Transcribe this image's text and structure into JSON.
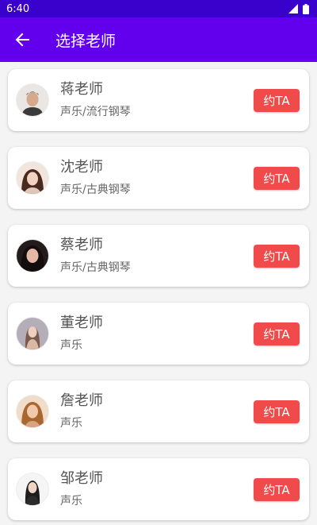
{
  "status_bar": {
    "time": "6:40"
  },
  "app_bar": {
    "title": "选择老师"
  },
  "teachers": [
    {
      "name": "蒋老师",
      "subject": "声乐/流行钢琴",
      "button": "约TA"
    },
    {
      "name": "沈老师",
      "subject": "声乐/古典钢琴",
      "button": "约TA"
    },
    {
      "name": "蔡老师",
      "subject": "声乐/古典钢琴",
      "button": "约TA"
    },
    {
      "name": "董老师",
      "subject": "声乐",
      "button": "约TA"
    },
    {
      "name": "詹老师",
      "subject": "声乐",
      "button": "约TA"
    },
    {
      "name": "邹老师",
      "subject": "声乐",
      "button": "约TA"
    }
  ],
  "colors": {
    "status_bar": "#3a00cc",
    "app_bar": "#6200ee",
    "button": "#f04a4a"
  }
}
